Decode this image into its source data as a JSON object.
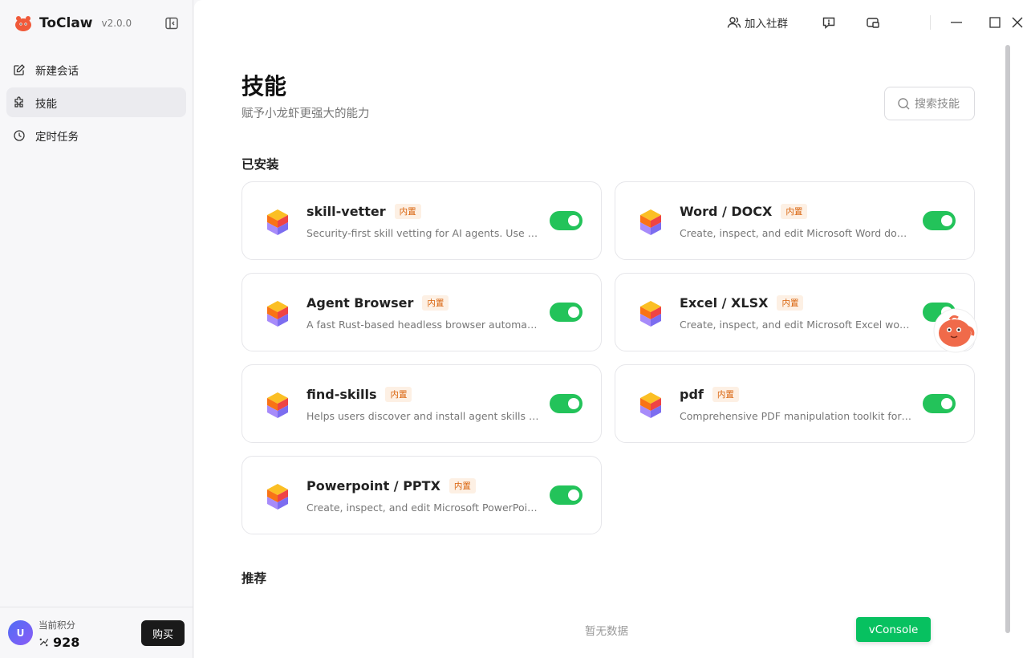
{
  "app": {
    "name": "ToClaw",
    "version": "v2.0.0"
  },
  "sidebar": {
    "items": [
      {
        "label": "新建会话",
        "icon": "edit-icon"
      },
      {
        "label": "技能",
        "icon": "puzzle-icon"
      },
      {
        "label": "定时任务",
        "icon": "clock-icon"
      }
    ],
    "active_index": 1
  },
  "user": {
    "avatar_letter": "U",
    "points_label": "当前积分",
    "points_value": "928",
    "buy_label": "购买"
  },
  "topbar": {
    "community_label": "加入社群"
  },
  "page": {
    "title": "技能",
    "subtitle": "赋予小龙虾更强大的能力",
    "search_placeholder": "搜索技能"
  },
  "sections": {
    "installed": "已安装",
    "recommended": "推荐",
    "empty_text": "暂无数据"
  },
  "skills": [
    {
      "name": "skill-vetter",
      "badge": "内置",
      "desc": "Security-first skill vetting for AI agents. Use before installing any skill.",
      "enabled": true
    },
    {
      "name": "Word / DOCX",
      "badge": "内置",
      "desc": "Create, inspect, and edit Microsoft Word documents.",
      "enabled": true
    },
    {
      "name": "Agent Browser",
      "badge": "内置",
      "desc": "A fast Rust-based headless browser automation CLI.",
      "enabled": true
    },
    {
      "name": "Excel / XLSX",
      "badge": "内置",
      "desc": "Create, inspect, and edit Microsoft Excel workbooks.",
      "enabled": true
    },
    {
      "name": "find-skills",
      "badge": "内置",
      "desc": "Helps users discover and install agent skills when they ask.",
      "enabled": true
    },
    {
      "name": "pdf",
      "badge": "内置",
      "desc": "Comprehensive PDF manipulation toolkit for extracting text.",
      "enabled": true
    },
    {
      "name": "Powerpoint / PPTX",
      "badge": "内置",
      "desc": "Create, inspect, and edit Microsoft PowerPoint presentations.",
      "enabled": true
    }
  ],
  "debug": {
    "vconsole_label": "vConsole"
  },
  "colors": {
    "toggle_on": "#23c35a",
    "badge_text": "#d9620a",
    "vconsole": "#07c160"
  }
}
